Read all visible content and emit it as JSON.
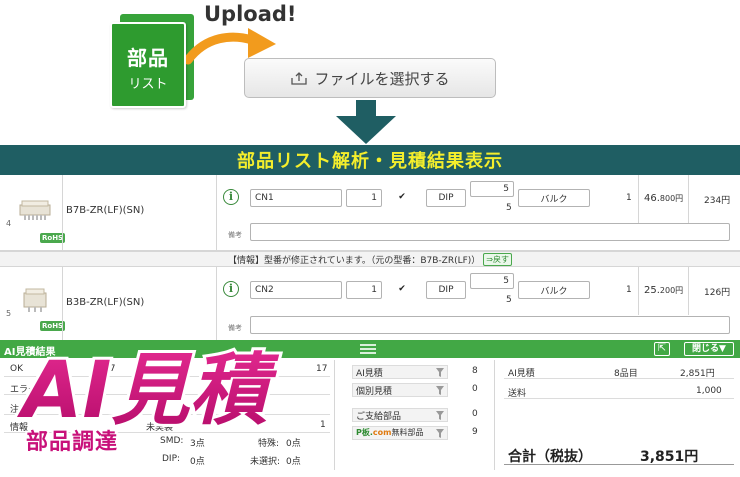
{
  "hero": {
    "card_line1": "部品",
    "card_line2": "リスト",
    "upload_label": "Upload!",
    "file_button_label": "ファイルを選択する"
  },
  "banner": {
    "title": "部品リスト解析・見積結果表示"
  },
  "results": {
    "rows": [
      {
        "num": "4",
        "rohs": "RoHS",
        "part_name": "B7B-ZR(LF)(SN)",
        "ref": "CN1",
        "qty": "1",
        "checked": "✔",
        "package": "DIP",
        "stock_top": "5",
        "stock_bottom": "5",
        "packing": "バルク",
        "order_qty": "1",
        "unit_price": "46.",
        "unit_price_small": "800円",
        "line_total": "234円",
        "remark_label": "備考"
      },
      {
        "num": "5",
        "rohs": "RoHS",
        "part_name": "B3B-ZR(LF)(SN)",
        "ref": "CN2",
        "qty": "1",
        "checked": "✔",
        "package": "DIP",
        "stock_top": "5",
        "stock_bottom": "5",
        "packing": "バルク",
        "order_qty": "1",
        "unit_price": "25.",
        "unit_price_small": "200円",
        "line_total": "126円",
        "remark_label": "備考"
      }
    ],
    "notice_text": "【情報】型番が修正されています。（元の型番：B7B-ZR(LF)）",
    "notice_button": "⇒戻す"
  },
  "ai_panel": {
    "header_title": "AI見積結果",
    "close_label": "閉じる▼",
    "left_stats": {
      "ok_label": "OK",
      "ok_value": "17",
      "ok_total": "17",
      "error_label": "エラー",
      "note_label": "注意",
      "info_label": "情報",
      "unmounted_label": "未実装",
      "unmounted_value": "1",
      "smd_label": "SMD:",
      "smd_value": "3点",
      "special_label": "特殊:",
      "special_value": "0点",
      "dip_label": "DIP:",
      "dip_value": "0点",
      "unselected_label": "未選択:",
      "unselected_value": "0点"
    },
    "middle": {
      "ai_quote_label": "AI見積",
      "ai_quote_value": "8",
      "individual_label": "個別見積",
      "individual_value": "0",
      "supplied_label": "ご支給部品",
      "supplied_value": "0",
      "pban_prefix": "P板.",
      "pban_com": "com",
      "pban_suffix": "無料部品",
      "pban_value": "9"
    },
    "right": {
      "ai_quote_label": "AI見積",
      "ai_quote_count": "8品目",
      "ai_quote_price": "2,851円",
      "shipping_label": "送料",
      "shipping_price": "1,000",
      "total_label": "合計（税抜）",
      "total_price": "3,851円"
    }
  },
  "logo": {
    "main": "AI見積",
    "sub": "部品調達"
  },
  "colors": {
    "green": "#42a845",
    "teal_banner": "#1f5e63",
    "banner_text": "#f4ee2c",
    "arrow_orange": "#f29b1d",
    "logo_magenta": "#c8117a"
  }
}
